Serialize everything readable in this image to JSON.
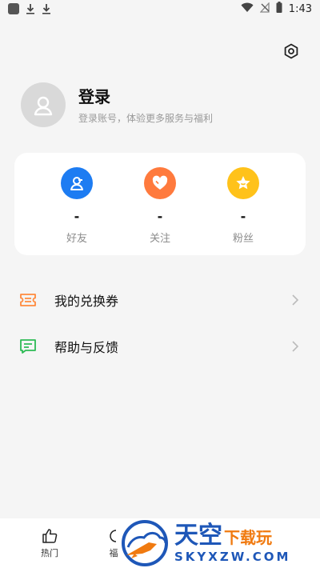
{
  "status_bar": {
    "time": "1:43",
    "icons": [
      "app-icon",
      "download-icon",
      "download-icon",
      "wifi-icon",
      "no-signal-icon",
      "battery-icon"
    ]
  },
  "settings": {
    "icon": "settings-hexagon-icon"
  },
  "profile": {
    "title": "登录",
    "subtitle": "登录账号，体验更多服务与福利",
    "avatar_icon": "person-icon"
  },
  "stats": [
    {
      "count": "-",
      "label": "好友",
      "icon": "friend-icon",
      "color": "#1d7cf2"
    },
    {
      "count": "-",
      "label": "关注",
      "icon": "heart-icon",
      "color": "#ff7a3d"
    },
    {
      "count": "-",
      "label": "粉丝",
      "icon": "star-icon",
      "color": "#ffc21a"
    }
  ],
  "menu": [
    {
      "label": "我的兑换券",
      "icon": "coupon-icon",
      "icon_color": "#ff8a3d"
    },
    {
      "label": "帮助与反馈",
      "icon": "feedback-icon",
      "icon_color": "#2dbb55"
    }
  ],
  "bottom_nav": [
    {
      "label": "热门",
      "icon": "thumbs-up-icon"
    },
    {
      "label": "福",
      "icon": "circle-icon"
    }
  ],
  "watermark": {
    "big": "天空",
    "small": "下载玩",
    "domain": "SKYXZW.COM"
  }
}
